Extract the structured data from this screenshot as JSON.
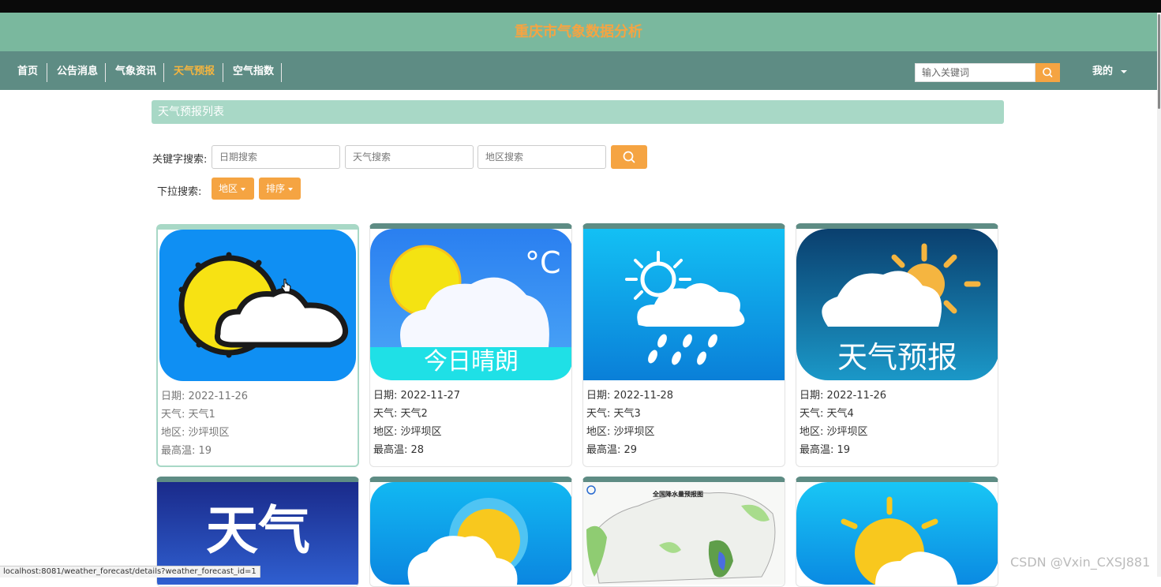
{
  "site_title": "重庆市气象数据分析",
  "nav": {
    "items": [
      {
        "label": "首页"
      },
      {
        "label": "公告消息"
      },
      {
        "label": "气象资讯"
      },
      {
        "label": "天气预报"
      },
      {
        "label": "空气指数"
      }
    ],
    "active": "天气预报",
    "search_placeholder": "输入关键词",
    "me_label": "我的"
  },
  "section_title": "天气预报列表",
  "search": {
    "keyword_label": "关键字搜索:",
    "date_placeholder": "日期搜索",
    "weather_placeholder": "天气搜索",
    "region_placeholder": "地区搜索",
    "dropdown_label": "下拉搜索:",
    "region_dropdown": "地区",
    "sort_dropdown": "排序"
  },
  "field_labels": {
    "date": "日期",
    "weather": "天气",
    "region": "地区",
    "max_temp": "最高温"
  },
  "cards": [
    {
      "date": "2022-11-26",
      "weather": "天气1",
      "region": "沙坪坝区",
      "max_temp": "19",
      "image_text": ""
    },
    {
      "date": "2022-11-27",
      "weather": "天气2",
      "region": "沙坪坝区",
      "max_temp": "28",
      "image_text": "今日晴朗"
    },
    {
      "date": "2022-11-28",
      "weather": "天气3",
      "region": "沙坪坝区",
      "max_temp": "29",
      "image_text": ""
    },
    {
      "date": "2022-11-26",
      "weather": "天气4",
      "region": "沙坪坝区",
      "max_temp": "19",
      "image_text": "天气预报"
    }
  ],
  "row2_images": [
    {
      "image_text": "天气"
    },
    {
      "image_text": ""
    },
    {
      "image_text": "全国降水量预报图"
    },
    {
      "image_text": ""
    }
  ],
  "status_url": "localhost:8081/weather_forecast/details?weather_forecast_id=1",
  "watermark": "CSDN @Vxin_CXSJ881",
  "colors": {
    "header": "#7ab89e",
    "nav": "#5e8c84",
    "accent": "#f5a442",
    "section": "#a8d8c6"
  }
}
